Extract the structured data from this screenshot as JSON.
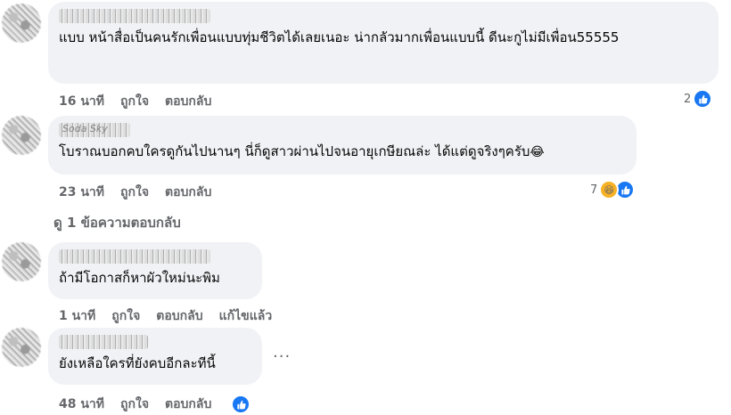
{
  "comments": [
    {
      "author": "",
      "text": "แบบ หน้าสื่อเป็นคนรักเพื่อนแบบทุ่มชีวิตได้เลยเนอะ น่ากลัวมากเพื่อนแบบนี้ ดีนะกูไม่มีเพื่อน55555",
      "time": "16 นาที",
      "like": "ถูกใจ",
      "reply": "ตอบกลับ",
      "reaction_count": "2"
    },
    {
      "author": "Soda Sky",
      "text": "โบราณบอกคบใครดูกันไปนานๆ นี่ก็ดูสาวผ่านไปจนอายุเกษียณล่ะ ได้แต่ดูจริงๆครับ",
      "emoji": "😂",
      "time": "23 นาที",
      "like": "ถูกใจ",
      "reply": "ตอบกลับ",
      "reaction_count": "7",
      "view_replies": "ดู 1 ข้อความตอบกลับ"
    },
    {
      "author": "",
      "text": "ถ้ามีโอกาสก็หาผัวใหม่นะพิม",
      "time": "1 นาที",
      "like": "ถูกใจ",
      "reply": "ตอบกลับ",
      "edited": "แก้ไขแล้ว"
    },
    {
      "author": "",
      "text": "ยังเหลือใครที่ยังคบอีกละทีนี้",
      "time": "48 นาที",
      "like": "ถูกใจ",
      "reply": "ตอบกลับ",
      "more": "···"
    }
  ],
  "colors": {
    "like_blue": "#1877f2",
    "bubble": "#f0f2f5",
    "meta": "#65676b"
  },
  "icons": {
    "like": "thumbs-up-icon",
    "haha": "laughing-face-icon"
  }
}
